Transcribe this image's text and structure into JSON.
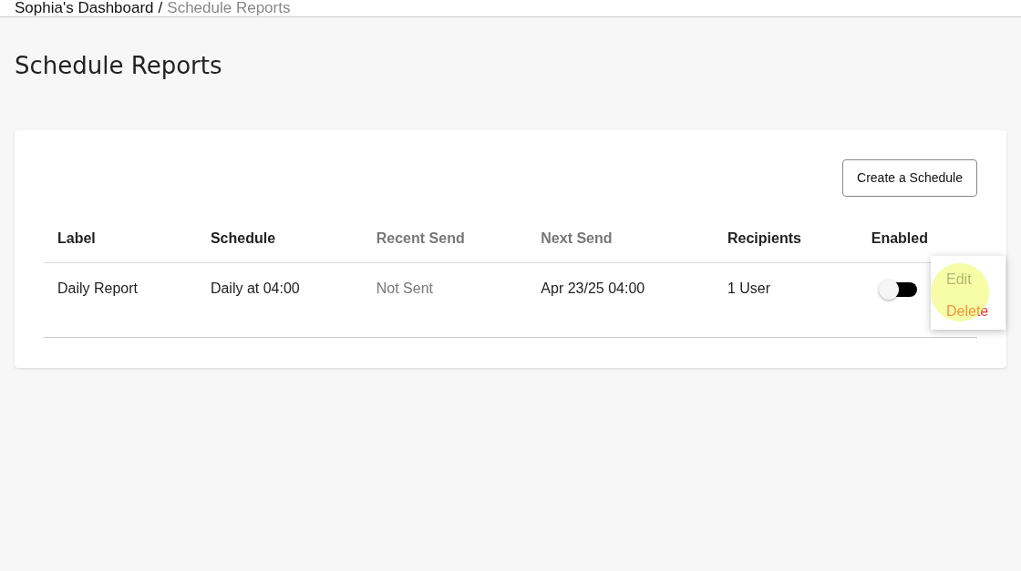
{
  "breadcrumb": [
    {
      "label": "Sophia's Dashboard",
      "current": false
    },
    {
      "label": "/",
      "current": false
    },
    {
      "label": "Schedule Reports",
      "current": true
    }
  ],
  "page_title": "Schedule Reports",
  "create_button": "Create a Schedule",
  "table": {
    "columns": [
      {
        "label": "Label",
        "muted": false
      },
      {
        "label": "Schedule",
        "muted": false
      },
      {
        "label": "Recent Send",
        "muted": true
      },
      {
        "label": "Next Send",
        "muted": true
      },
      {
        "label": "Recipients",
        "muted": false
      },
      {
        "label": "Enabled",
        "muted": false
      }
    ],
    "rows": [
      {
        "cells": [
          {
            "text": "Daily Report",
            "muted": false
          },
          {
            "text": "Daily at 04:00",
            "muted": false
          },
          {
            "text": "Not Sent",
            "muted": true
          },
          {
            "text": "Apr 23/25 04:00",
            "muted": false
          },
          {
            "text": "1 User",
            "muted": false
          }
        ],
        "enabled": false
      }
    ]
  },
  "row_menu": [
    {
      "label": "Edit",
      "kind": "normal"
    },
    {
      "label": "Delete",
      "kind": "danger"
    }
  ]
}
